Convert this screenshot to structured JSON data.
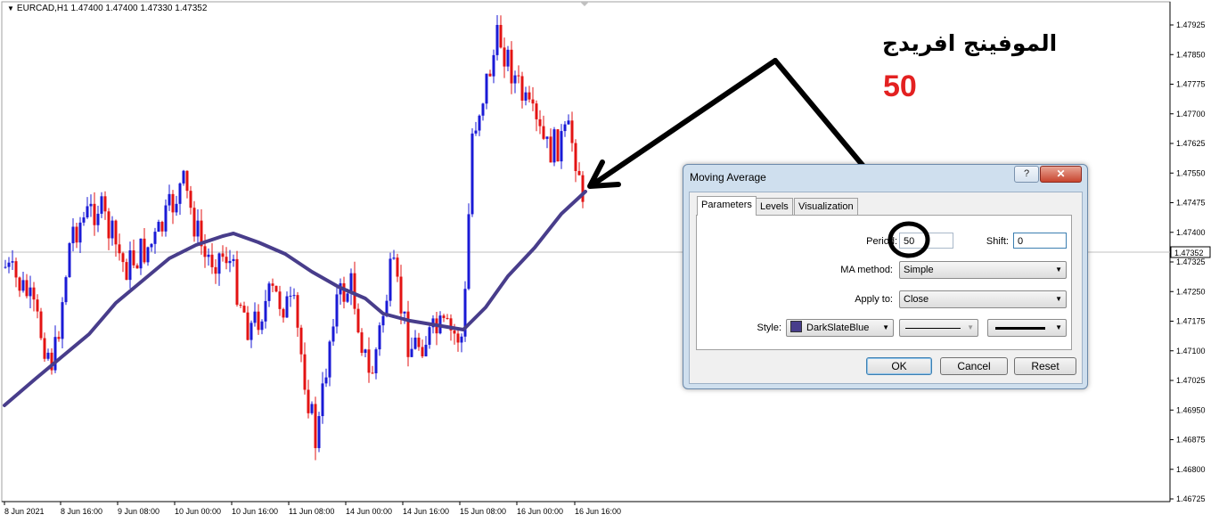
{
  "chart": {
    "symbol_header": "EURCAD,H1  1.47400 1.47400 1.47330 1.47352",
    "current_price": "1.47352",
    "price_labels": [
      "1.47925",
      "1.47850",
      "1.47775",
      "1.47700",
      "1.47625",
      "1.47550",
      "1.47475",
      "1.47400",
      "1.47325",
      "1.47250",
      "1.47175",
      "1.47100",
      "1.47025",
      "1.46950",
      "1.46875",
      "1.46800",
      "1.46725"
    ],
    "time_labels": [
      "8 Jun 2021",
      "8 Jun 16:00",
      "9 Jun 08:00",
      "10 Jun 00:00",
      "10 Jun 16:00",
      "11 Jun 08:00",
      "14 Jun 00:00",
      "14 Jun 16:00",
      "15 Jun 08:00",
      "16 Jun 00:00",
      "16 Jun 16:00"
    ],
    "colors": {
      "bull": "#1a1ad6",
      "bear": "#e31313",
      "ma": "#483d8b",
      "grid": "#c0c0c0",
      "arrow": "#000000"
    }
  },
  "annotation": {
    "arabic_text": "الموفينج افريدج",
    "number": "50",
    "number_color": "#e32121"
  },
  "dialog": {
    "title": "Moving Average",
    "help_label": "?",
    "close_label": "✕",
    "tabs": [
      "Parameters",
      "Levels",
      "Visualization"
    ],
    "period_label": "Period:",
    "period_value": "50",
    "shift_label": "Shift:",
    "shift_value": "0",
    "method_label": "MA method:",
    "method_value": "Simple",
    "apply_label": "Apply to:",
    "apply_value": "Close",
    "style_label": "Style:",
    "style_color": "DarkSlateBlue",
    "ok_label": "OK",
    "cancel_label": "Cancel",
    "reset_label": "Reset"
  }
}
